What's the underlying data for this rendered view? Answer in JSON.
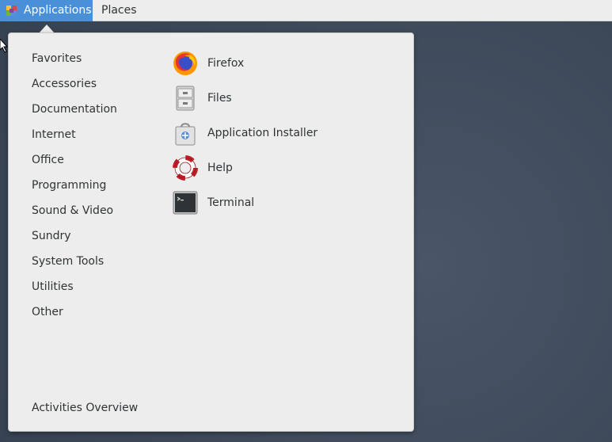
{
  "topbar": {
    "applications_label": "Applications",
    "places_label": "Places"
  },
  "menu": {
    "categories": [
      "Favorites",
      "Accessories",
      "Documentation",
      "Internet",
      "Office",
      "Programming",
      "Sound & Video",
      "Sundry",
      "System Tools",
      "Utilities",
      "Other"
    ],
    "apps": [
      {
        "label": "Firefox",
        "icon": "firefox-icon"
      },
      {
        "label": "Files",
        "icon": "files-icon"
      },
      {
        "label": "Application Installer",
        "icon": "application-installer-icon"
      },
      {
        "label": "Help",
        "icon": "help-icon"
      },
      {
        "label": "Terminal",
        "icon": "terminal-icon"
      }
    ],
    "activities_overview_label": "Activities Overview"
  },
  "colors": {
    "accent": "#4a90d9",
    "desktop": "#3f4b5b",
    "menu_bg": "#ededed",
    "text": "#2e3436"
  }
}
